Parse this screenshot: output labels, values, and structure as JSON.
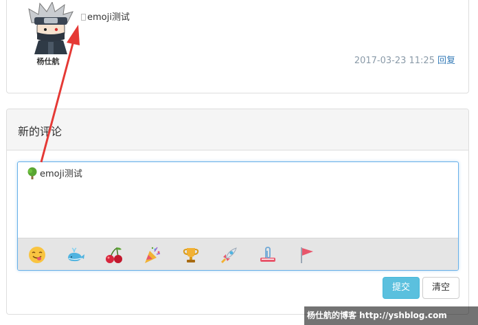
{
  "comment": {
    "username": "杨仕航",
    "text": "emoji测试",
    "timestamp": "2017-03-23 11:25",
    "reply_label": "回复"
  },
  "new_comment": {
    "title": "新的评论",
    "editor_text": "emoji测试",
    "emoji_buttons": [
      "smiley-tongue-icon",
      "whale-icon",
      "cherries-icon",
      "party-popper-icon",
      "trophy-icon",
      "rocket-icon",
      "paperclip-book-icon",
      "flag-icon"
    ],
    "submit_label": "提交",
    "clear_label": "清空"
  },
  "colors": {
    "primary_link": "#337ab7",
    "submit_button": "#5bc0de",
    "editor_focus_border": "#66afe9",
    "arrow": "#e53935"
  },
  "watermark": "杨仕航的博客 http://yshblog.com"
}
